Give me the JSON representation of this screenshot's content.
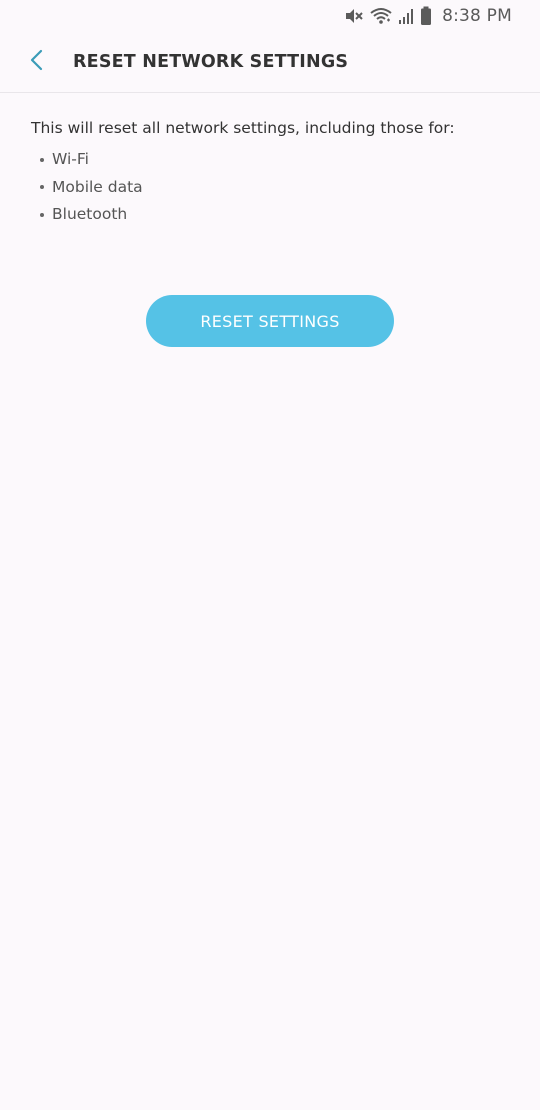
{
  "status_bar": {
    "time": "8:38 PM",
    "icons": [
      "mute-icon",
      "wifi-icon",
      "signal-icon",
      "battery-icon"
    ]
  },
  "header": {
    "back_icon": "chevron-left-icon",
    "title": "RESET NETWORK SETTINGS"
  },
  "content": {
    "intro": "This will reset all network settings, including those for:",
    "items": [
      "Wi-Fi",
      "Mobile data",
      "Bluetooth"
    ]
  },
  "actions": {
    "reset_label": "RESET SETTINGS"
  },
  "colors": {
    "accent": "#55c2e6",
    "back_icon": "#3b9cb8",
    "background": "#fcf9fc"
  }
}
